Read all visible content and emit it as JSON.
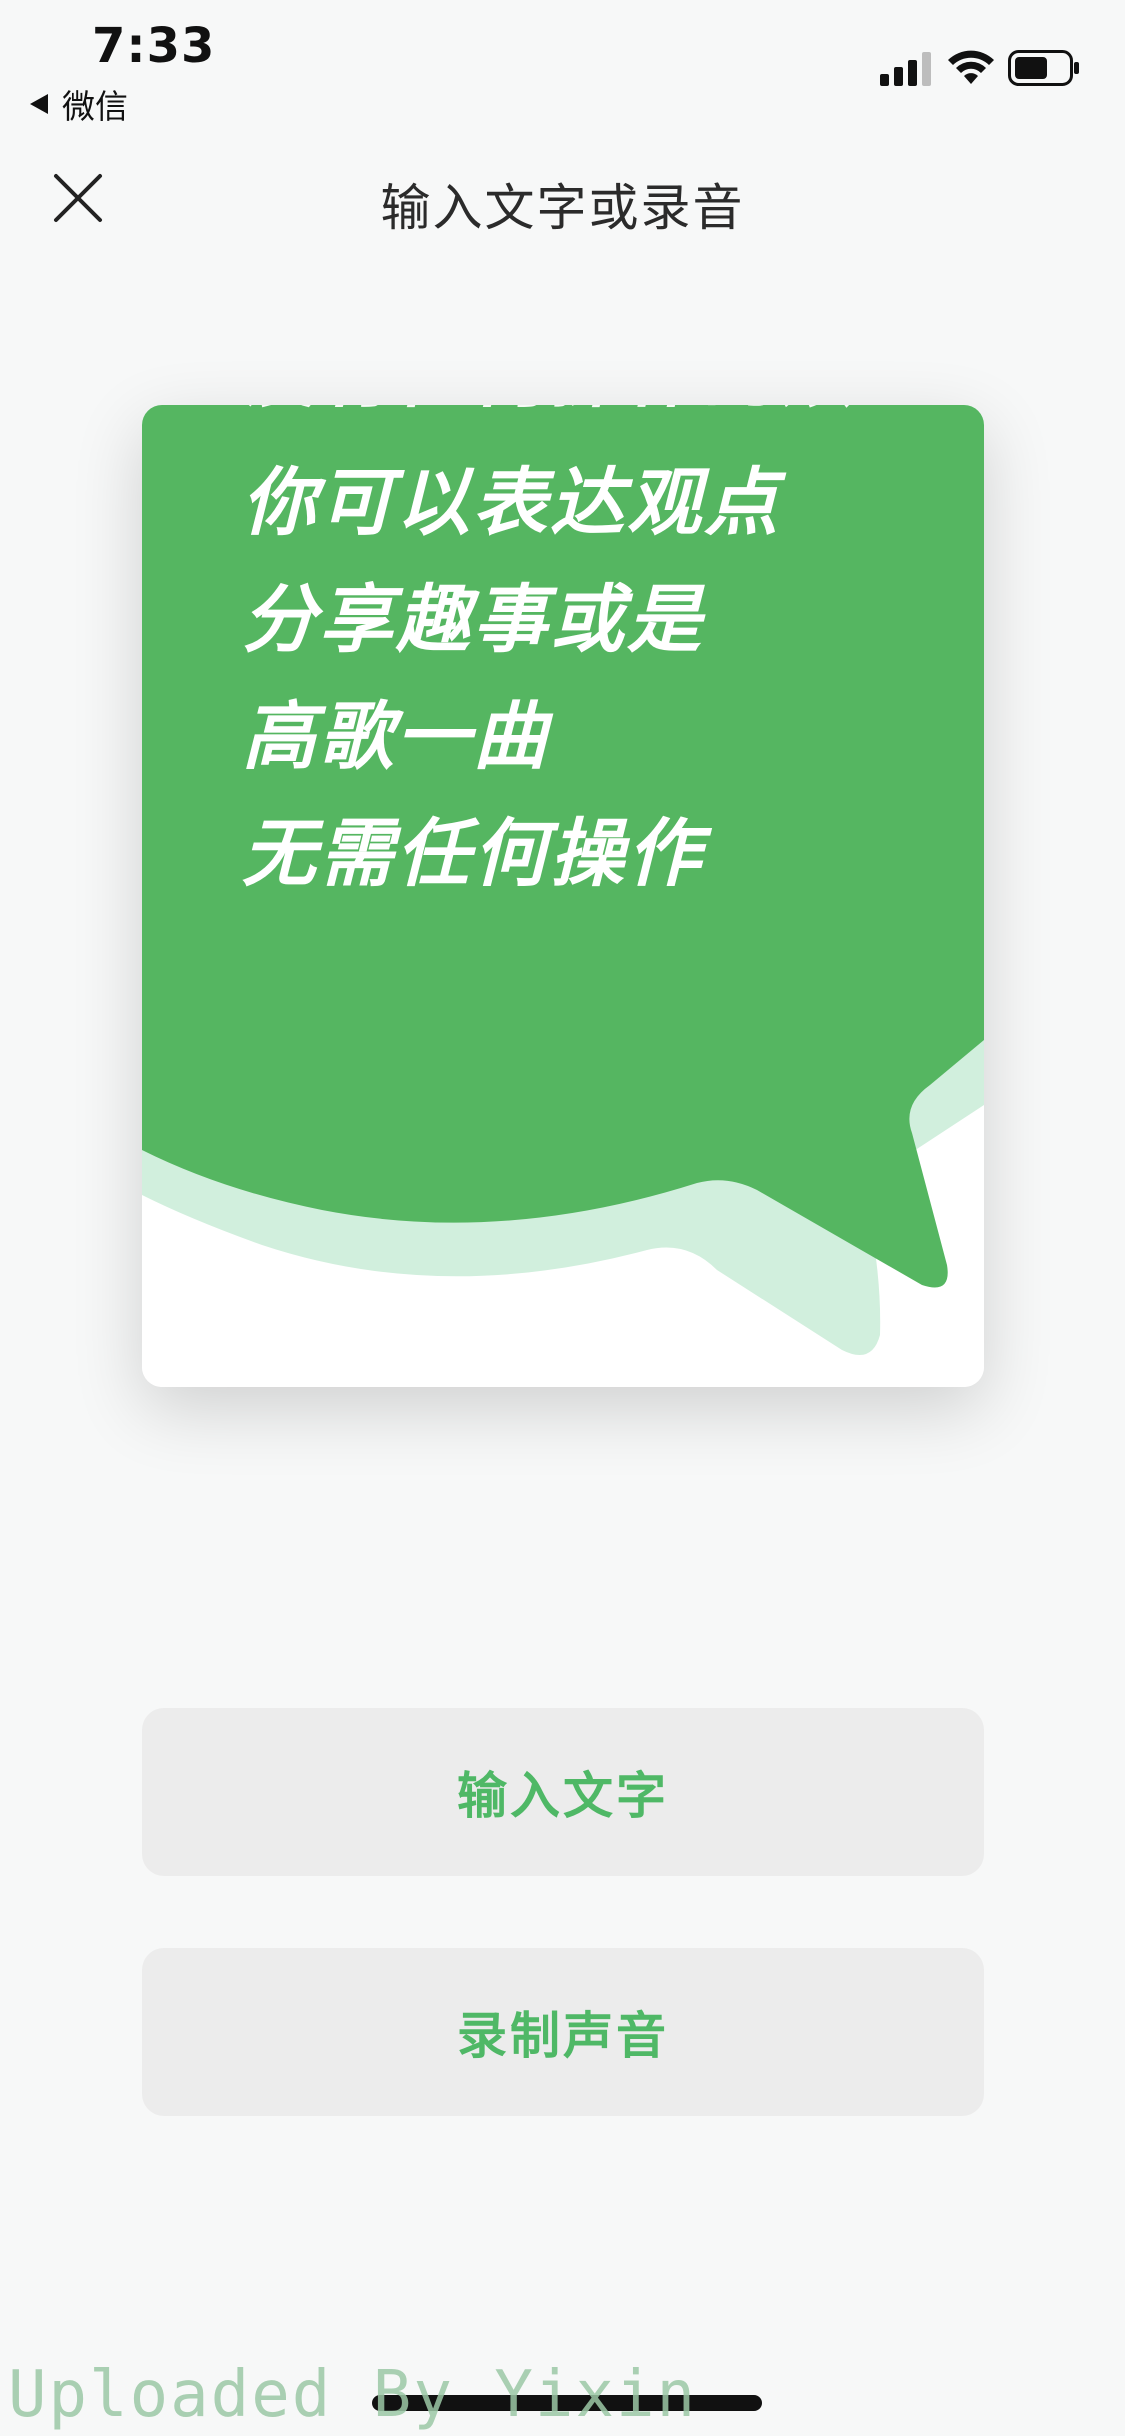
{
  "status_bar": {
    "time": "7:33",
    "back_app_label": "微信"
  },
  "header": {
    "title": "输入文字或录音"
  },
  "card": {
    "cut_line": "没有任何操作的烦",
    "lines": [
      "你可以表达观点",
      "分享趣事或是",
      "高歌一曲",
      "无需任何操作"
    ],
    "colors": {
      "green": "#55b661",
      "light_green": "#d1efdd",
      "white": "#ffffff"
    }
  },
  "actions": {
    "input_text_label": "输入文字",
    "record_voice_label": "录制声音",
    "accent_color": "#4fb866"
  },
  "watermark": "Uploaded By Yixin",
  "icons": [
    "close-icon",
    "signal-icon",
    "wifi-icon",
    "battery-icon",
    "back-triangle-icon"
  ]
}
